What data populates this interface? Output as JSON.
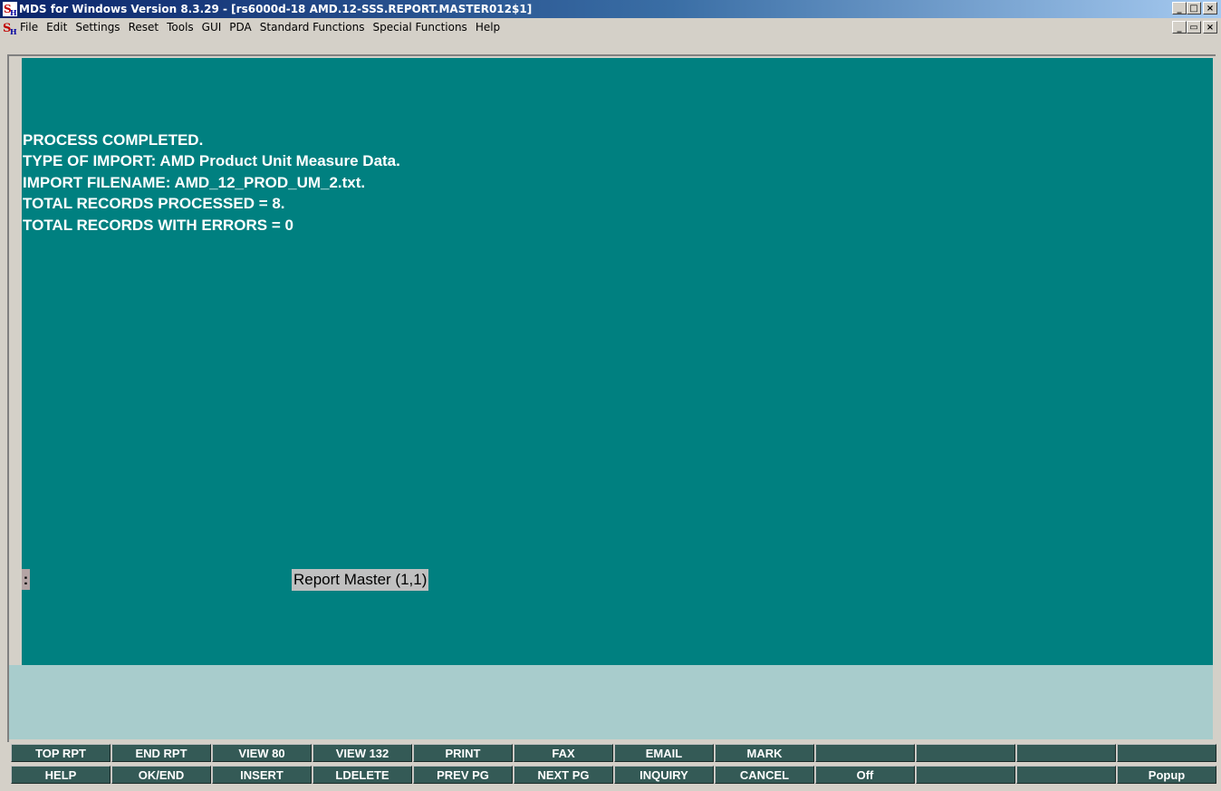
{
  "window": {
    "title": "MDS for Windows Version 8.3.29 - [rs6000d-18 AMD.12-SSS.REPORT.MASTER012$1]",
    "app_icon": "sh-logo-icon",
    "buttons": {
      "minimize": "_",
      "maximize": "□",
      "close": "×"
    }
  },
  "menubar": {
    "items": [
      "File",
      "Edit",
      "Settings",
      "Reset",
      "Tools",
      "GUI",
      "PDA",
      "Standard Functions",
      "Special Functions",
      "Help"
    ],
    "buttons": {
      "minimize": "_",
      "restore": "▭",
      "close": "×"
    }
  },
  "terminal": {
    "lines": [
      "PROCESS COMPLETED.",
      "TYPE OF IMPORT:  AMD Product Unit Measure Data.",
      "IMPORT FILENAME: AMD_12_PROD_UM_2.txt.",
      "TOTAL RECORDS PROCESSED = 8.",
      "TOTAL RECORDS WITH ERRORS = 0"
    ],
    "prompt": ":",
    "report_label": "Report Master (1,1)"
  },
  "function_keys": {
    "row1": [
      "TOP RPT",
      "END RPT",
      "VIEW 80",
      "VIEW 132",
      "PRINT",
      "FAX",
      "EMAIL",
      "MARK",
      "",
      "",
      "",
      ""
    ],
    "row2": [
      "HELP",
      "OK/END",
      "INSERT",
      "LDELETE",
      "PREV PG",
      "NEXT PG",
      "INQUIRY",
      "CANCEL",
      "Off",
      "",
      "",
      "Popup"
    ]
  },
  "colors": {
    "terminal_bg": "#008080",
    "status_bg": "#a8cccc",
    "fkey_bg": "#345a56",
    "titlebar_start": "#0a246a",
    "titlebar_end": "#a6caf0"
  }
}
